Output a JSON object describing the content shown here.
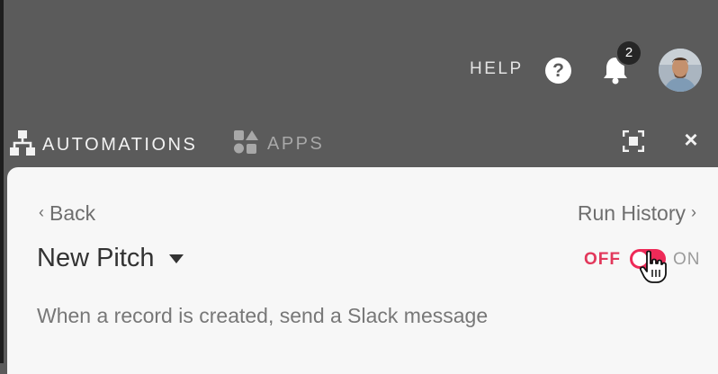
{
  "topbar": {
    "help_label": "HELP",
    "help_icon_glyph": "?",
    "notifications_count": "2"
  },
  "tabs": [
    {
      "label": "AUTOMATIONS",
      "icon": "automations-icon",
      "active": true
    },
    {
      "label": "APPS",
      "icon": "apps-icon",
      "active": false
    }
  ],
  "panel_actions": {
    "close_glyph": "×"
  },
  "automation": {
    "back_label": "Back",
    "back_chevron": "‹",
    "run_history_label": "Run History",
    "run_history_chevron": "›",
    "name": "New Pitch",
    "toggle_off_label": "OFF",
    "toggle_on_label": "ON",
    "enabled": false,
    "description": "When a record is created, send a Slack message"
  },
  "colors": {
    "background": "#5b5b5b",
    "panel": "#f7f7f7",
    "accent": "#ee2a58",
    "off_text": "#e2385b"
  }
}
